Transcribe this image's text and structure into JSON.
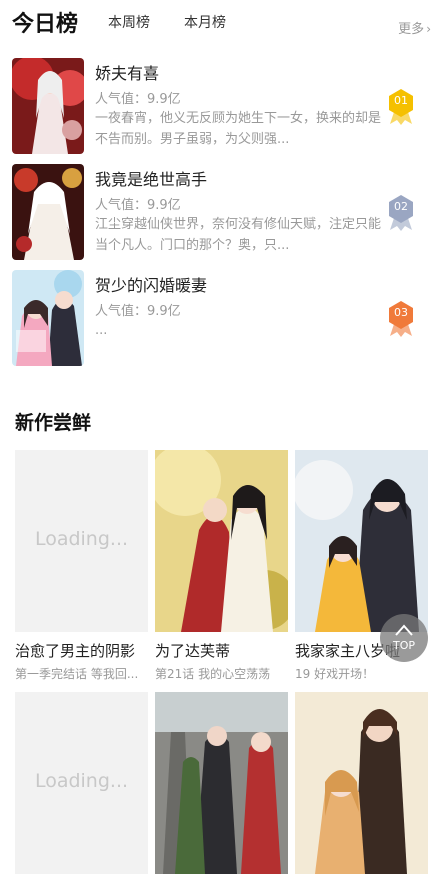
{
  "rank": {
    "title": "今日榜",
    "tabs": [
      "本周榜",
      "本月榜"
    ],
    "more": "更多",
    "items": [
      {
        "name": "娇夫有喜",
        "popularity": "人气值：9.9亿",
        "desc": "一夜春宵，他义无反顾为她生下一女，换来的却是不告而别。男子虽弱，为父则强...",
        "rank": "01",
        "color": "#f5c000"
      },
      {
        "name": "我竟是绝世高手",
        "popularity": "人气值：9.9亿",
        "desc": "江尘穿越仙侠世界，奈何没有修仙天赋，注定只能当个凡人。门口的那个？奥，只...",
        "rank": "02",
        "color": "#9aa6c2"
      },
      {
        "name": "贺少的闪婚暖妻",
        "popularity": "人气值：9.9亿",
        "desc": "...",
        "rank": "03",
        "color": "#f07a3a"
      }
    ]
  },
  "new_section": {
    "title": "新作尝鲜",
    "loading": "Loading...",
    "cards": [
      {
        "title": "治愈了男主的阴影",
        "sub": "第一季完结话 等我回..."
      },
      {
        "title": "为了达芙蒂",
        "sub": "第21话 我的心空荡荡"
      },
      {
        "title": "我家家主八岁啦",
        "sub": "19 好戏开场！"
      }
    ]
  },
  "top_button": "TOP"
}
